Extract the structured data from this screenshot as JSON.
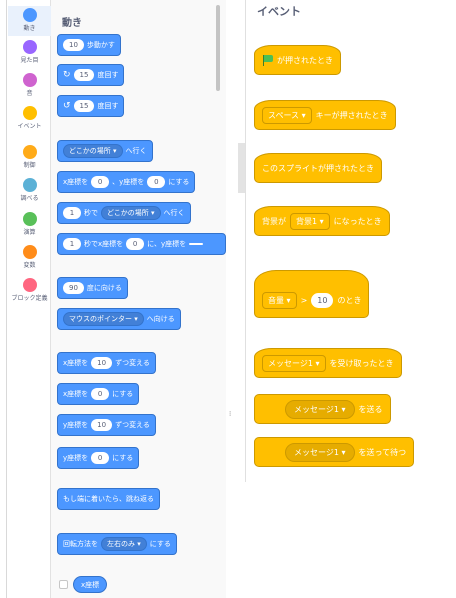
{
  "categories": [
    {
      "label": "動き",
      "color": "#4c97ff",
      "selected": true
    },
    {
      "label": "見た目",
      "color": "#9966ff"
    },
    {
      "label": "音",
      "color": "#cf63cf"
    },
    {
      "label": "イベント",
      "color": "#ffbf00"
    },
    {
      "label": "制御",
      "color": "#ffab19"
    },
    {
      "label": "調べる",
      "color": "#5cb1d6"
    },
    {
      "label": "演算",
      "color": "#59c059"
    },
    {
      "label": "変数",
      "color": "#ff8c1a"
    },
    {
      "label": "ブロック定義",
      "color": "#ff6680"
    }
  ],
  "motion": {
    "heading": "動き",
    "move": {
      "value": "10",
      "text": "歩動かす"
    },
    "turn_right": {
      "value": "15",
      "text": "度回す"
    },
    "turn_left": {
      "value": "15",
      "text": "度回す"
    },
    "goto": {
      "option": "どこかの場所",
      "text": "へ行く"
    },
    "goto_xy": {
      "t1": "x座標を",
      "x": "0",
      "t2": "、y座標を",
      "y": "0",
      "t3": "にする"
    },
    "glide": {
      "secs": "1",
      "t1": "秒で",
      "option": "どこかの場所",
      "t2": "へ行く"
    },
    "glide_xy": {
      "secs": "1",
      "t1": "秒でx座標を",
      "x": "0",
      "t2": "に、y座標を",
      "y": ""
    },
    "point_dir": {
      "value": "90",
      "text": "度に向ける"
    },
    "point_towards": {
      "option": "マウスのポインター",
      "text": "へ向ける"
    },
    "change_x": {
      "t1": "x座標を",
      "value": "10",
      "t2": "ずつ変える"
    },
    "set_x": {
      "t1": "x座標を",
      "value": "0",
      "t2": "にする"
    },
    "change_y": {
      "t1": "y座標を",
      "value": "10",
      "t2": "ずつ変える"
    },
    "set_y": {
      "t1": "y座標を",
      "value": "0",
      "t2": "にする"
    },
    "bounce": "もし端に着いたら、跳ね返る",
    "rotation": {
      "t1": "回転方法を",
      "option": "左右のみ",
      "t2": "にする"
    },
    "xpos": "x座標"
  },
  "events": {
    "heading": "イベント",
    "flag_clicked": "が押されたとき",
    "key_pressed": {
      "option": "スペース",
      "text": "キーが押されたとき"
    },
    "sprite_clicked": "このスプライトが押されたとき",
    "backdrop": {
      "t1": "背景が",
      "option": "背景1",
      "t2": "になったとき"
    },
    "greater": {
      "option": "音量",
      "op": ">",
      "value": "10",
      "t2": "のとき"
    },
    "receive": {
      "option": "メッセージ1",
      "text": "を受け取ったとき"
    },
    "broadcast": {
      "option": "メッセージ1",
      "text": "を送る"
    },
    "broadcast_wait": {
      "option": "メッセージ1",
      "text": "を送って待つ"
    }
  }
}
